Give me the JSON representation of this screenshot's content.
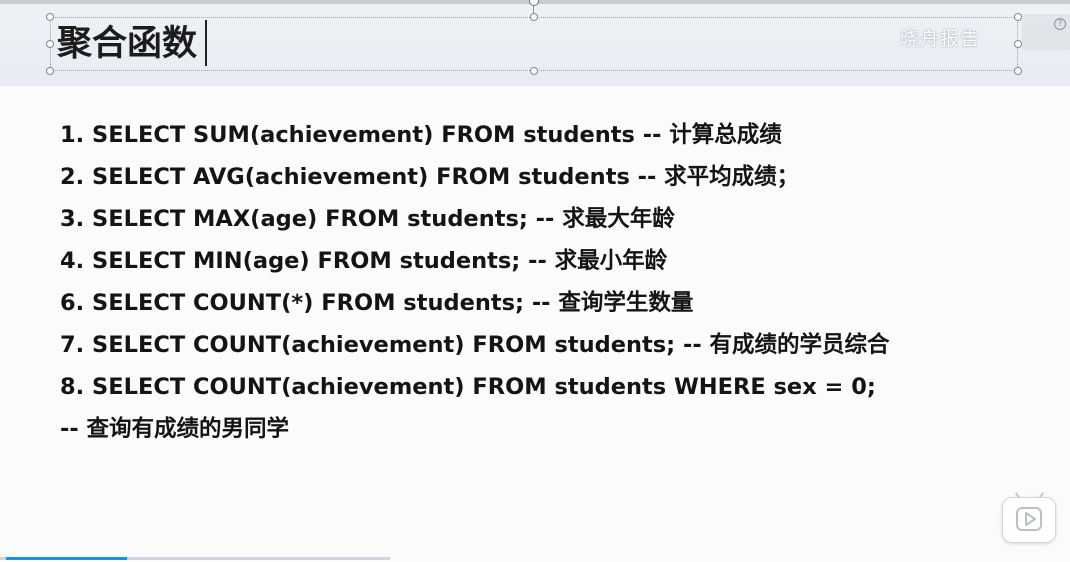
{
  "slide": {
    "title": "聚合函数",
    "watermark": "晓舟报告",
    "help_glyph": "?",
    "lines": [
      "1. SELECT SUM(achievement) FROM students  -- 计算总成绩",
      "2. SELECT AVG(achievement) FROM students -- 求平均成绩；",
      "3. SELECT MAX(age) FROM students; -- 求最大年龄",
      "4. SELECT MIN(age) FROM students; -- 求最小年龄",
      "6. SELECT COUNT(*) FROM students; -- 查询学生数量",
      "7. SELECT COUNT(achievement) FROM students; -- 有成绩的学员综合",
      "8. SELECT COUNT(achievement) FROM students WHERE sex = 0;",
      "-- 查询有成绩的男同学"
    ]
  },
  "player": {
    "play_icon": "play-icon",
    "accent_color": "#1f8fe0",
    "progress_percent": 31
  }
}
